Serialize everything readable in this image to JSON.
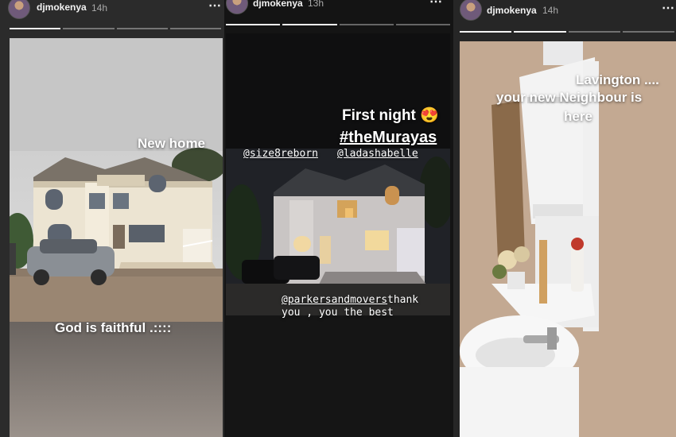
{
  "stories": [
    {
      "username": "djmokenya",
      "time": "14h",
      "more_icon": "⋯",
      "progress_segments": 4,
      "progress_done": 1,
      "texts": {
        "caption_top": "New home",
        "caption_bottom": "God is faithful .::::"
      }
    },
    {
      "username": "djmokenya",
      "time": "13h",
      "more_icon": "⋯",
      "progress_segments": 4,
      "progress_done": 2,
      "texts": {
        "caption_title": "First night 😍",
        "hashtag": "#theMurayas",
        "mention_1": "@size8reborn",
        "mention_2": "@ladashabelle",
        "mention_3": "@parkersandmovers",
        "thanks_1": " thank",
        "thanks_2": "you , you the best"
      }
    },
    {
      "username": "djmokenya",
      "time": "14h",
      "more_icon": "⋯",
      "progress_segments": 4,
      "progress_done": 2,
      "texts": {
        "line_1": "Lavington ....",
        "line_2": "your new Neighbour is",
        "line_3": "here"
      }
    }
  ]
}
